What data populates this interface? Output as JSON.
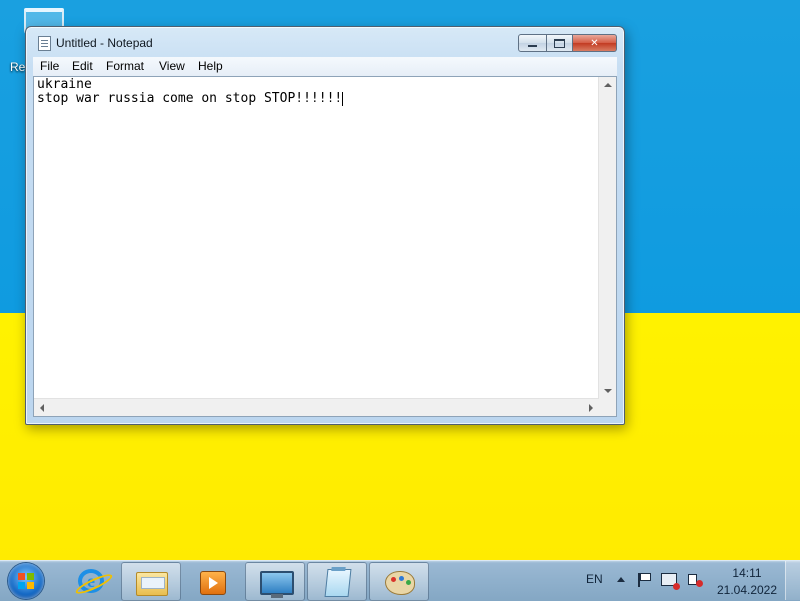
{
  "desktop": {
    "recycle_bin_label": "Re"
  },
  "window": {
    "title": "Untitled - Notepad",
    "menu": {
      "file": "File",
      "edit": "Edit",
      "format": "Format",
      "view": "View",
      "help": "Help"
    },
    "content": {
      "line1": "ukraine",
      "line2": "stop war russia come on stop STOP!!!!!!"
    }
  },
  "taskbar": {
    "pinned": [
      "internet-explorer-icon",
      "windows-explorer-icon",
      "windows-media-player-icon",
      "remote-desktop-icon",
      "notepad-icon",
      "paint-icon"
    ],
    "active_app": "notepad",
    "tray": {
      "language": "EN",
      "time": "14:11",
      "date": "21.04.2022"
    }
  },
  "colors": {
    "flag_blue": "#0f9be0",
    "flag_yellow": "#fff200"
  }
}
